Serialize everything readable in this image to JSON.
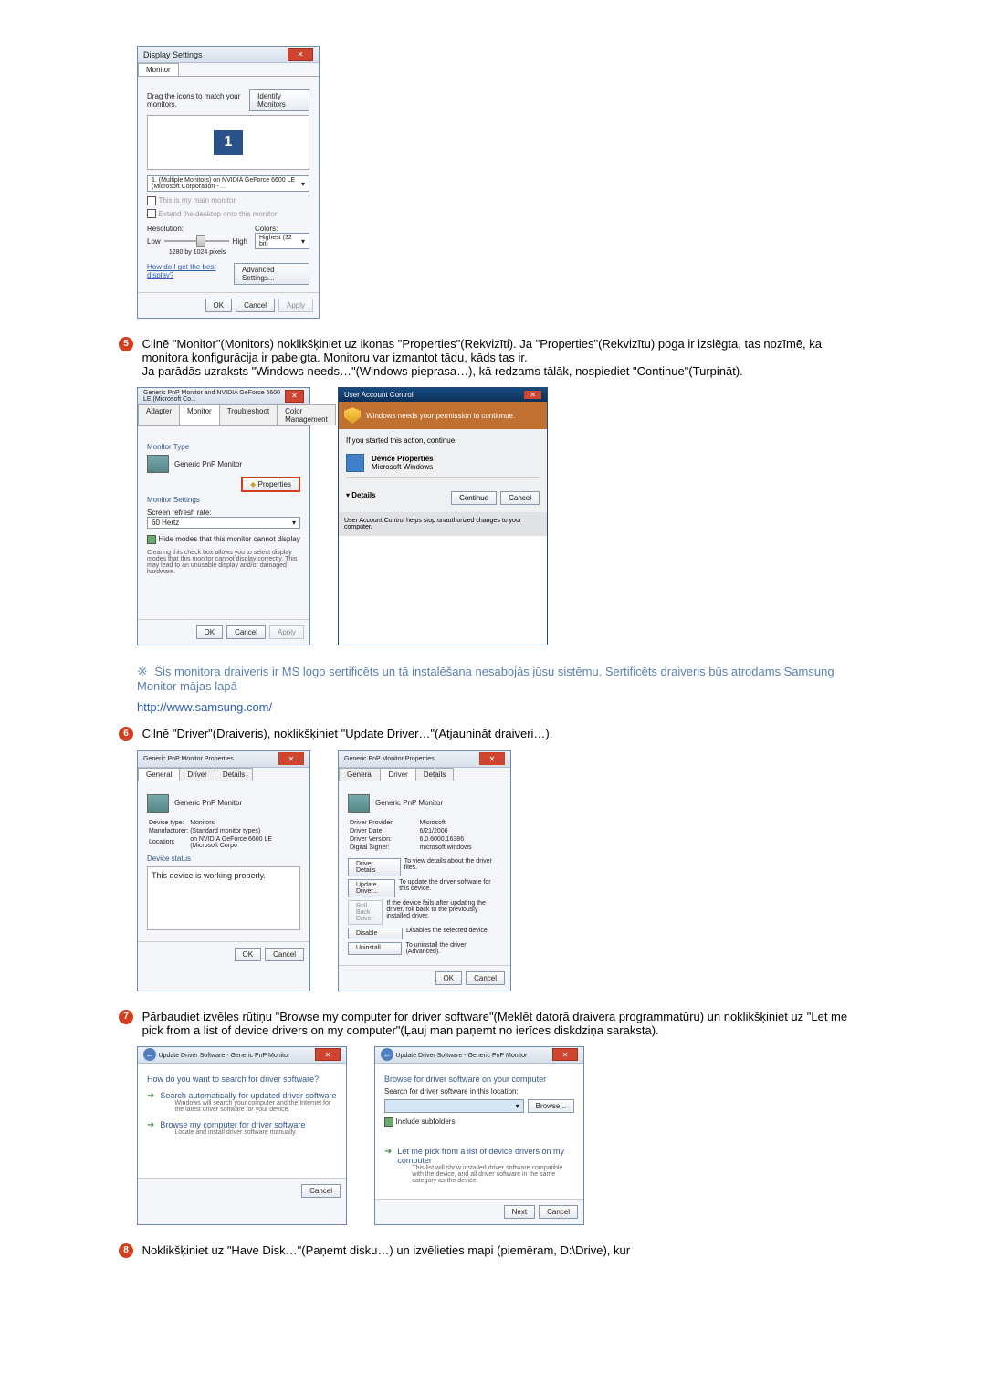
{
  "display_settings": {
    "title": "Display Settings",
    "tab": "Monitor",
    "drag_text": "Drag the icons to match your monitors.",
    "identify_btn": "Identify Monitors",
    "monitor_dropdown": "1. (Multiple Monitors) on NVIDIA GeForce 6600 LE (Microsoft Corporation - …",
    "main_check": "This is my main monitor",
    "extend_check": "Extend the desktop onto this monitor",
    "resolution_label": "Resolution:",
    "res_low": "Low",
    "res_high": "High",
    "res_value": "1280 by 1024 pixels",
    "colors_label": "Colors:",
    "colors_value": "Highest (32 bit)",
    "help_link": "How do I get the best display?",
    "advanced_btn": "Advanced Settings...",
    "ok": "OK",
    "cancel": "Cancel",
    "apply": "Apply"
  },
  "step5": "Cilnē \"Monitor\"(Monitors) noklikšķiniet uz ikonas \"Properties\"(Rekvizīti). Ja \"Properties\"(Rekvizītu) poga ir izslēgta, tas nozīmē, ka monitora konfigurācija ir pabeigta. Monitoru var izmantot tādu, kāds tas ir.",
  "step5_sub": "Ja parādās uzraksts \"Windows needs…\"(Windows pieprasa…), kā redzams tālāk, nospiediet \"Continue\"(Turpināt).",
  "monitor_tab": {
    "title": "Generic PnP Monitor and NVIDIA GeForce 6600 LE (Microsoft Co...",
    "tabs": [
      "Adapter",
      "Monitor",
      "Troubleshoot",
      "Color Management"
    ],
    "monitor_type_label": "Monitor Type",
    "monitor_name": "Generic PnP Monitor",
    "properties_btn": "Properties",
    "settings_label": "Monitor Settings",
    "refresh_label": "Screen refresh rate:",
    "refresh_value": "60 Hertz",
    "hide_check": "Hide modes that this monitor cannot display",
    "hide_desc": "Clearing this check box allows you to select display modes that this monitor cannot display correctly. This may lead to an unusable display and/or damaged hardware.",
    "ok": "OK",
    "cancel": "Cancel",
    "apply": "Apply"
  },
  "uac": {
    "title": "User Account Control",
    "banner": "Windows needs your permission to contionue.",
    "started": "If you started this action, continue.",
    "prog_name": "Device Properties",
    "prog_pub": "Microsoft Windows",
    "details": "Details",
    "continue": "Continue",
    "cancel": "Cancel",
    "footer": "User Account Control helps stop unauthorized changes to your computer."
  },
  "note_text": "Šis monitora draiveris ir MS logo sertificēts un tā instalēšana nesabojās jūsu sistēmu. Sertificēts draiveris būs atrodams Samsung Monitor mājas lapā",
  "samsung_link": "http://www.samsung.com/",
  "step6": "Cilnē \"Driver\"(Draiveris), noklikšķiniet \"Update Driver…\"(Atjaunināt draiveri…).",
  "driver_general": {
    "title": "Generic PnP Monitor Properties",
    "tabs": [
      "General",
      "Driver",
      "Details"
    ],
    "name": "Generic PnP Monitor",
    "device_type_label": "Device type:",
    "device_type": "Monitors",
    "manufacturer_label": "Manufacturer:",
    "manufacturer": "(Standard monitor types)",
    "location_label": "Location:",
    "location": "on NVIDIA GeForce 6600 LE (Microsoft Corpo",
    "status_label": "Device status",
    "status_text": "This device is working properly.",
    "ok": "OK",
    "cancel": "Cancel"
  },
  "driver_tab": {
    "title": "Generic PnP Monitor Properties",
    "tabs": [
      "General",
      "Driver",
      "Details"
    ],
    "name": "Generic PnP Monitor",
    "provider_label": "Driver Provider:",
    "provider": "Microsoft",
    "date_label": "Driver Date:",
    "date": "6/21/2006",
    "version_label": "Driver Version:",
    "version": "6.0.6000.16386",
    "signer_label": "Digital Signer:",
    "signer": "microsoft windows",
    "details_btn": "Driver Details",
    "details_desc": "To view details about the driver files.",
    "update_btn": "Update Driver...",
    "update_desc": "To update the driver software for this device.",
    "rollback_btn": "Roll Back Driver",
    "rollback_desc": "If the device fails after updating the driver, roll back to the previously installed driver.",
    "disable_btn": "Disable",
    "disable_desc": "Disables the selected device.",
    "uninstall_btn": "Uninstall",
    "uninstall_desc": "To uninstall the driver (Advanced).",
    "ok": "OK",
    "cancel": "Cancel"
  },
  "step7": "Pārbaudiet izvēles rūtiņu \"Browse my computer for driver software\"(Meklēt datorā draivera programmatūru) un noklikšķiniet uz \"Let me pick from a list of device drivers on my computer\"(Ļauj man paņemt no ierīces diskdziņa saraksta).",
  "wizard1": {
    "title": "Update Driver Software - Generic PnP Monitor",
    "heading": "How do you want to search for driver software?",
    "auto_title": "Search automatically for updated driver software",
    "auto_desc": "Windows will search your computer and the Internet for the latest driver software for your device.",
    "browse_title": "Browse my computer for driver software",
    "browse_desc": "Locate and install driver software manually.",
    "cancel": "Cancel"
  },
  "wizard2": {
    "title": "Update Driver Software - Generic PnP Monitor",
    "heading": "Browse for driver software on your computer",
    "search_label": "Search for driver software in this location:",
    "path": "",
    "browse_btn": "Browse...",
    "include_check": "Include subfolders",
    "pick_title": "Let me pick from a list of device drivers on my computer",
    "pick_desc": "This list will show installed driver software compatible with the device, and all driver software in the same category as the device.",
    "next": "Next",
    "cancel": "Cancel"
  },
  "step8": "Noklikšķiniet uz \"Have Disk…\"(Paņemt disku…) un izvēlieties mapi (piemēram, D:\\Drive), kur"
}
